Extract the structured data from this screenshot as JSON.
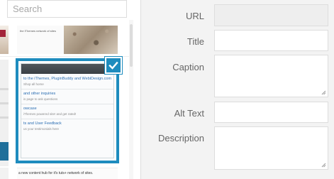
{
  "search": {
    "placeholder": "Search",
    "value": ""
  },
  "thumbnails": {
    "top_caption": "the iThemes network of sites",
    "bottom_caption": "a new content hub for it's tuts+ network of sites."
  },
  "selected_attachment": {
    "lines": [
      {
        "text": "to the iThemes, PluginBuddy and WebiDesign.com",
        "kind": "link"
      },
      {
        "text": "Shop all home",
        "kind": "sub"
      },
      {
        "text": "and other inquiries",
        "kind": "link"
      },
      {
        "text": "is page to ask questions",
        "kind": "sub"
      },
      {
        "text": "owcase",
        "kind": "link"
      },
      {
        "text": "iThemes powered site! and get rated!",
        "kind": "sub"
      },
      {
        "text": "ts and User Feedback",
        "kind": "link"
      },
      {
        "text": "us your testimonials here",
        "kind": "sub"
      }
    ],
    "checked": true,
    "check_icon": "checkmark-icon"
  },
  "details": {
    "url_label": "URL",
    "url_value": "",
    "title_label": "Title",
    "title_value": "",
    "caption_label": "Caption",
    "caption_value": "",
    "alt_label": "Alt Text",
    "alt_value": "",
    "description_label": "Description",
    "description_value": ""
  },
  "colors": {
    "accent": "#1e8cbe",
    "sidebar_bg": "#f3f3f3",
    "label_text": "#666666"
  }
}
